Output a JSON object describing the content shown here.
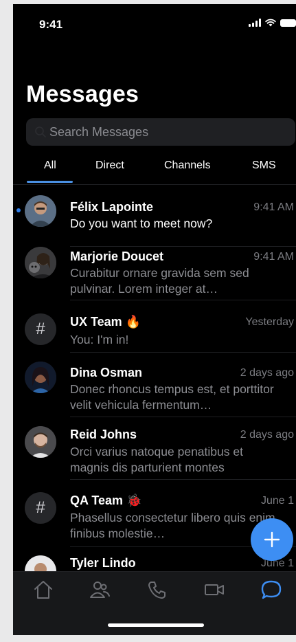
{
  "status": {
    "time": "9:41"
  },
  "title": "Messages",
  "search": {
    "placeholder": "Search Messages",
    "icon": "search-icon"
  },
  "tabs": [
    {
      "label": "All",
      "selected": true
    },
    {
      "label": "Direct",
      "selected": false
    },
    {
      "label": "Channels",
      "selected": false
    },
    {
      "label": "SMS",
      "selected": false
    }
  ],
  "conversations": [
    {
      "name": "Félix Lapointe",
      "time": "9:41 AM",
      "message": "Do you want to meet now?",
      "unread": true,
      "avatar": "photo"
    },
    {
      "name": "Marjorie Doucet",
      "time": "9:41 AM",
      "message": "Curabitur ornare gravida sem sed pulvinar. Lorem integer at…",
      "unread": false,
      "avatar": "photo"
    },
    {
      "name": "UX Team 🔥",
      "time": "Yesterday",
      "message": "You: I'm in!",
      "unread": false,
      "avatar": "channel-hash"
    },
    {
      "name": "Dina Osman",
      "time": "2 days ago",
      "message": "Donec rhoncus tempus est, et porttitor velit vehicula fermentum…",
      "unread": false,
      "avatar": "photo"
    },
    {
      "name": "Reid Johns",
      "time": "2 days ago",
      "message": "Orci varius natoque penatibus et magnis dis parturient montes",
      "unread": false,
      "avatar": "photo"
    },
    {
      "name": "QA Team 🐞",
      "time": "June 1",
      "message": "Phasellus consectetur libero quis enim finibus molestie…",
      "unread": false,
      "avatar": "channel-hash"
    },
    {
      "name": "Tyler Lindo",
      "time": "June 1",
      "message": "",
      "unread": false,
      "avatar": "photo"
    }
  ],
  "hash_symbol": "#",
  "fab": {
    "icon": "plus-icon"
  },
  "bottom_nav": [
    {
      "icon": "home-icon",
      "active": false
    },
    {
      "icon": "contacts-icon",
      "active": false
    },
    {
      "icon": "phone-icon",
      "active": false
    },
    {
      "icon": "video-icon",
      "active": false
    },
    {
      "icon": "chat-bubble-icon",
      "active": true
    }
  ],
  "colors": {
    "accent": "#3d8ef3",
    "background": "#000000",
    "muted_text": "#8d8e93",
    "unread_dot": "#2f80ed"
  }
}
